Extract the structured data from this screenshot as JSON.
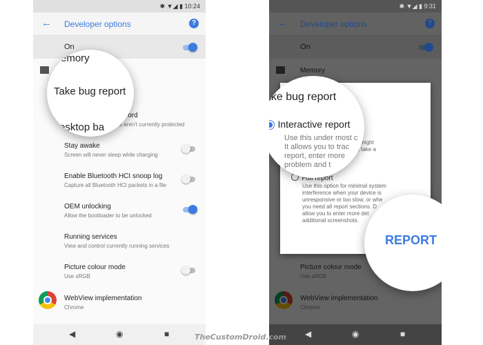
{
  "left": {
    "status": {
      "time": "10:24",
      "icons": [
        "bluetooth-icon",
        "wifi-icon",
        "signal-icon",
        "battery-icon"
      ]
    },
    "appbar": {
      "title": "Developer options",
      "help": "?"
    },
    "on_label": "On",
    "on_enabled": true,
    "items": [
      {
        "title": "Memory"
      },
      {
        "title": "Backup password",
        "subtitle": "Desktop full backups aren't currently protected",
        "visible_title": "sword",
        "visible_subtitle": "s aren't currently protected"
      },
      {
        "title": "Stay awake",
        "subtitle": "Screen will never sleep while charging",
        "toggle": false
      },
      {
        "title": "Enable Bluetooth HCI snoop log",
        "subtitle": "Capture all Bluetooth HCI packets in a file",
        "toggle": false
      },
      {
        "title": "OEM unlocking",
        "subtitle": "Allow the bootloader to be unlocked",
        "toggle": true
      },
      {
        "title": "Running services",
        "subtitle": "View and control currently running services"
      },
      {
        "title": "Picture colour mode",
        "subtitle": "Use sRGB",
        "toggle": false
      },
      {
        "title": "WebView implementation",
        "subtitle": "Chrome"
      }
    ],
    "magnifier": {
      "top": "emory",
      "main": "Take bug report",
      "bottom": "esktop ba"
    }
  },
  "right": {
    "status": {
      "time": "9:31"
    },
    "appbar": {
      "title": "Developer options"
    },
    "on_label": "On",
    "memory": "Memory",
    "picture": {
      "title": "Picture colour mode",
      "subtitle": "Use sRGB"
    },
    "webview": {
      "title": "WebView implementation",
      "subtitle": "Chrome"
    },
    "dialog": {
      "title": "Take bug report",
      "interactive": {
        "label": "Interactive report",
        "desc": "Use this under most circumstances. It allows you to track progress of the report, enter more details about the problem and take screenshots. It might omit some less-used sections that take a long time to report.",
        "visible": "cumstances.\nogress of the\nails about the\nreenshots. It might\nsections that take a",
        "mag_lines": [
          "Use this under most c",
          "It allows you to trac",
          "report, enter more",
          "problem and t"
        ]
      },
      "full": {
        "label": "Full report",
        "desc": "Use this option for minimal system interference when your device is unresponsive or too slow, or when you need all report sections. Does not allow you to enter more details or take additional screenshots.",
        "lines": [
          "Use this option for minimal system",
          "interference when your device is",
          "unresponsive or too slow, or whe",
          "you need all report sections. D",
          "allow you to enter more det",
          "additional screenshots."
        ]
      },
      "button": "REPORT"
    }
  },
  "nav": {
    "back": "◀",
    "home": "◉",
    "recents": "■"
  },
  "watermark": "TheCustomDroid.com",
  "colors": {
    "accent": "#3c7be0"
  }
}
